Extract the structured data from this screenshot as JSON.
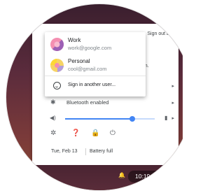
{
  "accounts": [
    {
      "name": "Work",
      "email": "work@google.com"
    },
    {
      "name": "Personal",
      "email": "cool@gmail.com"
    }
  ],
  "account_menu": {
    "sign_in_label": "Sign in another user..."
  },
  "tray": {
    "sign_out_label": "Sign out all",
    "partial_text": "om.",
    "bluetooth_label": "Bluetooth enabled",
    "volume_fraction": 0.75,
    "date": "Tue, Feb 13",
    "battery": "Battery full"
  },
  "shelf": {
    "time": "10:19"
  },
  "colors": {
    "accent": "#4285f4"
  }
}
